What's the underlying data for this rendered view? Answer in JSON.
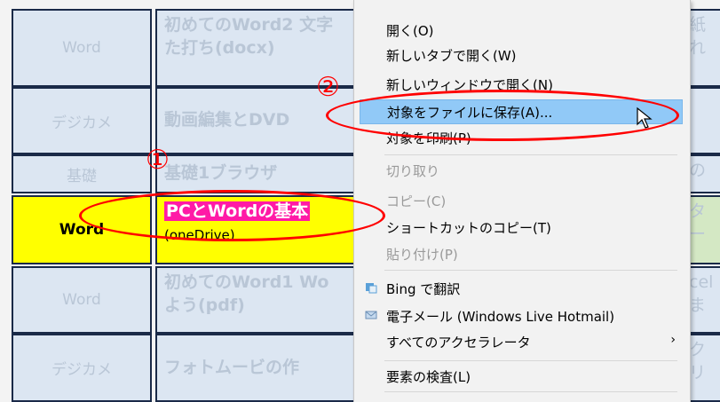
{
  "rows": [
    {
      "cat": "Word",
      "title": "初めてのWord2  文字",
      "sub": "た打ち(docx)",
      "right": "紙れ"
    },
    {
      "cat": "デジカメ",
      "title": "動画編集とDVD",
      "sub": "",
      "right": ""
    },
    {
      "cat": "基礎",
      "title": "基礎1ブラウザ",
      "sub": "",
      "right": "の"
    },
    {
      "cat": "Word",
      "title": "PCとWordの基本",
      "sub": "(oneDrive)",
      "right": "ター"
    },
    {
      "cat": "Word",
      "title": "初めてのWord1  Wo",
      "sub": "よう(pdf)",
      "right": "celま"
    },
    {
      "cat": "デジカメ",
      "title": "フォトムービの作",
      "sub": "",
      "right": "クリ"
    }
  ],
  "menu": {
    "items": [
      {
        "label": "開く(O)",
        "disabled": false,
        "icon": ""
      },
      {
        "label": "新しいタブで開く(W)",
        "disabled": false,
        "icon": ""
      },
      {
        "label": "新しいウィンドウで開く(N)",
        "disabled": false,
        "icon": ""
      },
      {
        "label": "対象をファイルに保存(A)...",
        "disabled": false,
        "icon": "",
        "hover": true
      },
      {
        "label": "対象を印刷(P)",
        "disabled": false,
        "icon": ""
      },
      {
        "label": "切り取り",
        "disabled": true,
        "icon": ""
      },
      {
        "label": "コピー(C)",
        "disabled": true,
        "icon": ""
      },
      {
        "label": "ショートカットのコピー(T)",
        "disabled": false,
        "icon": ""
      },
      {
        "label": "貼り付け(P)",
        "disabled": true,
        "icon": ""
      },
      {
        "label": "Bing で翻訳",
        "disabled": false,
        "icon": "translate-icon"
      },
      {
        "label": "電子メール (Windows Live Hotmail)",
        "disabled": false,
        "icon": "mail-icon"
      },
      {
        "label": "すべてのアクセラレータ",
        "disabled": false,
        "icon": "",
        "submenu_arrow": "›"
      },
      {
        "label": "要素の検査(L)",
        "disabled": false,
        "icon": ""
      }
    ]
  },
  "annotations": {
    "one": "①",
    "two": "②"
  },
  "colors": {
    "highlight": "#ffff00",
    "pink": "#ff1aa6",
    "menu_hover": "#91c9f7",
    "annotation": "#ff0000"
  }
}
